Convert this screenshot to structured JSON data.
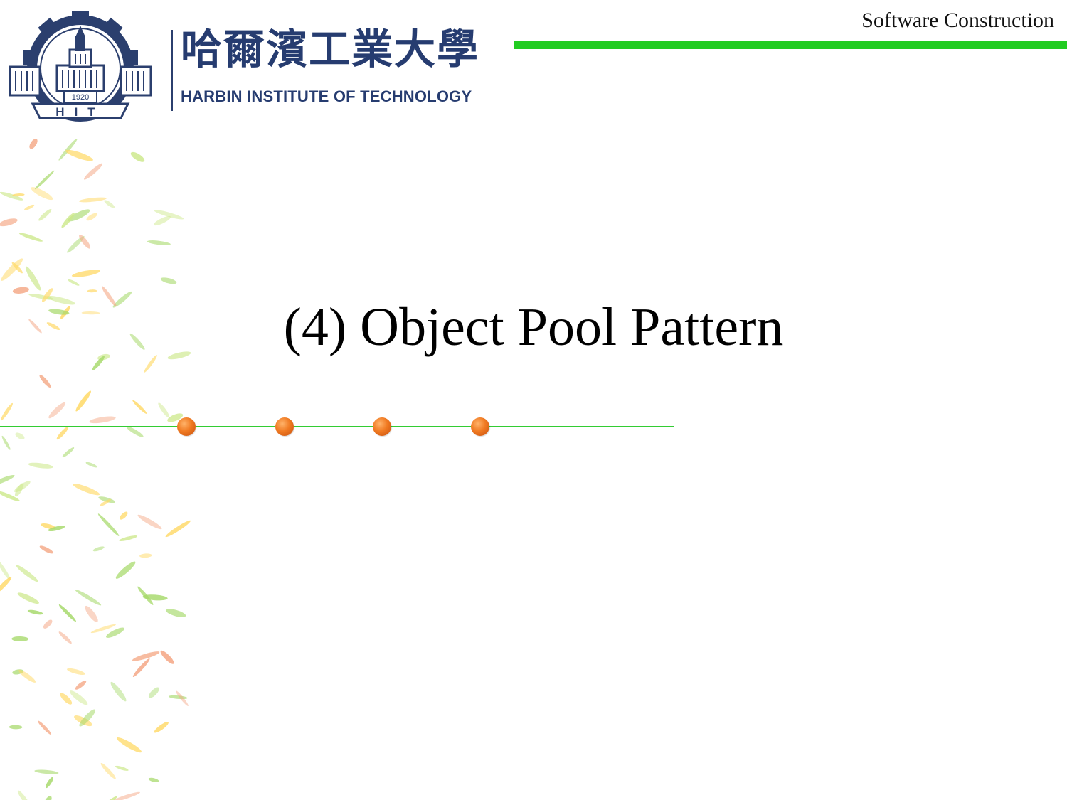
{
  "header": {
    "caption": "Software Construction",
    "accent_color": "#22cc22"
  },
  "logo": {
    "emblem_icon": "hit-emblem-icon",
    "chinese_name": "哈爾濱工業大學",
    "english_name": "HARBIN INSTITUTE OF TECHNOLOGY",
    "brand_color": "#263c70"
  },
  "slide": {
    "title": "(4) Object Pool Pattern"
  },
  "decoration": {
    "bullet_color": "#f07a22",
    "rule_color": "#33cc33",
    "leaf_colors": [
      "#a6d96a",
      "#ffd966",
      "#f4a582",
      "#cce88a"
    ]
  }
}
